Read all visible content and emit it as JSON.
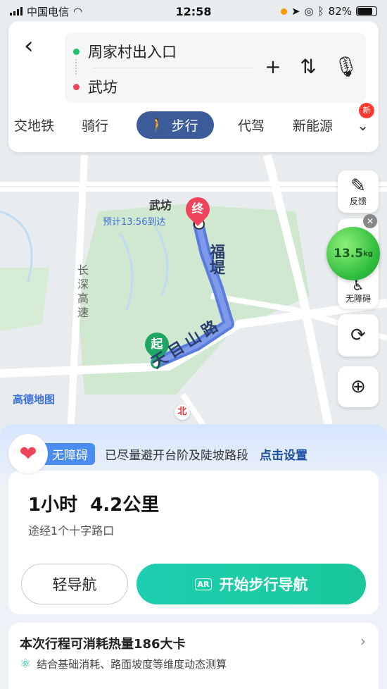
{
  "status_bar": {
    "carrier": "中国电信",
    "time": "12:58",
    "battery": "82%"
  },
  "route": {
    "from": "周家村出入口",
    "to": "武坊",
    "from_color": "#1fbf6e",
    "to_color": "#f0435a"
  },
  "modes": {
    "items": [
      "交地铁",
      "骑行",
      "步行",
      "代驾",
      "新能源"
    ],
    "active": "步行",
    "new_badge": "新"
  },
  "map": {
    "destination_label": "武坊",
    "end_marker": "终",
    "start_marker": "起",
    "eta_text": "预计13:56到达",
    "road_names": [
      "福堤",
      "天目山路",
      "长深高速"
    ],
    "logo_text": "高德地图",
    "compass": "北",
    "route_color": "#5a7be0"
  },
  "side_buttons": {
    "feedback": "反馈",
    "accessible": "无障碍",
    "carbon_value": "13.5",
    "carbon_unit": "kg"
  },
  "accessibility": {
    "tag": "无障碍",
    "text": "已尽量避开台阶及陡坡路段",
    "link": "点击设置"
  },
  "summary": {
    "duration": "1小时",
    "distance": "4.2公里",
    "via": "途经1个十字路口"
  },
  "buttons": {
    "light_nav": "轻导航",
    "start_nav": "开始步行导航",
    "ar_badge": "AR"
  },
  "calories": {
    "title": "本次行程可消耗热量186大卡",
    "subtitle": "结合基础消耗、路面坡度等维度动态测算"
  }
}
